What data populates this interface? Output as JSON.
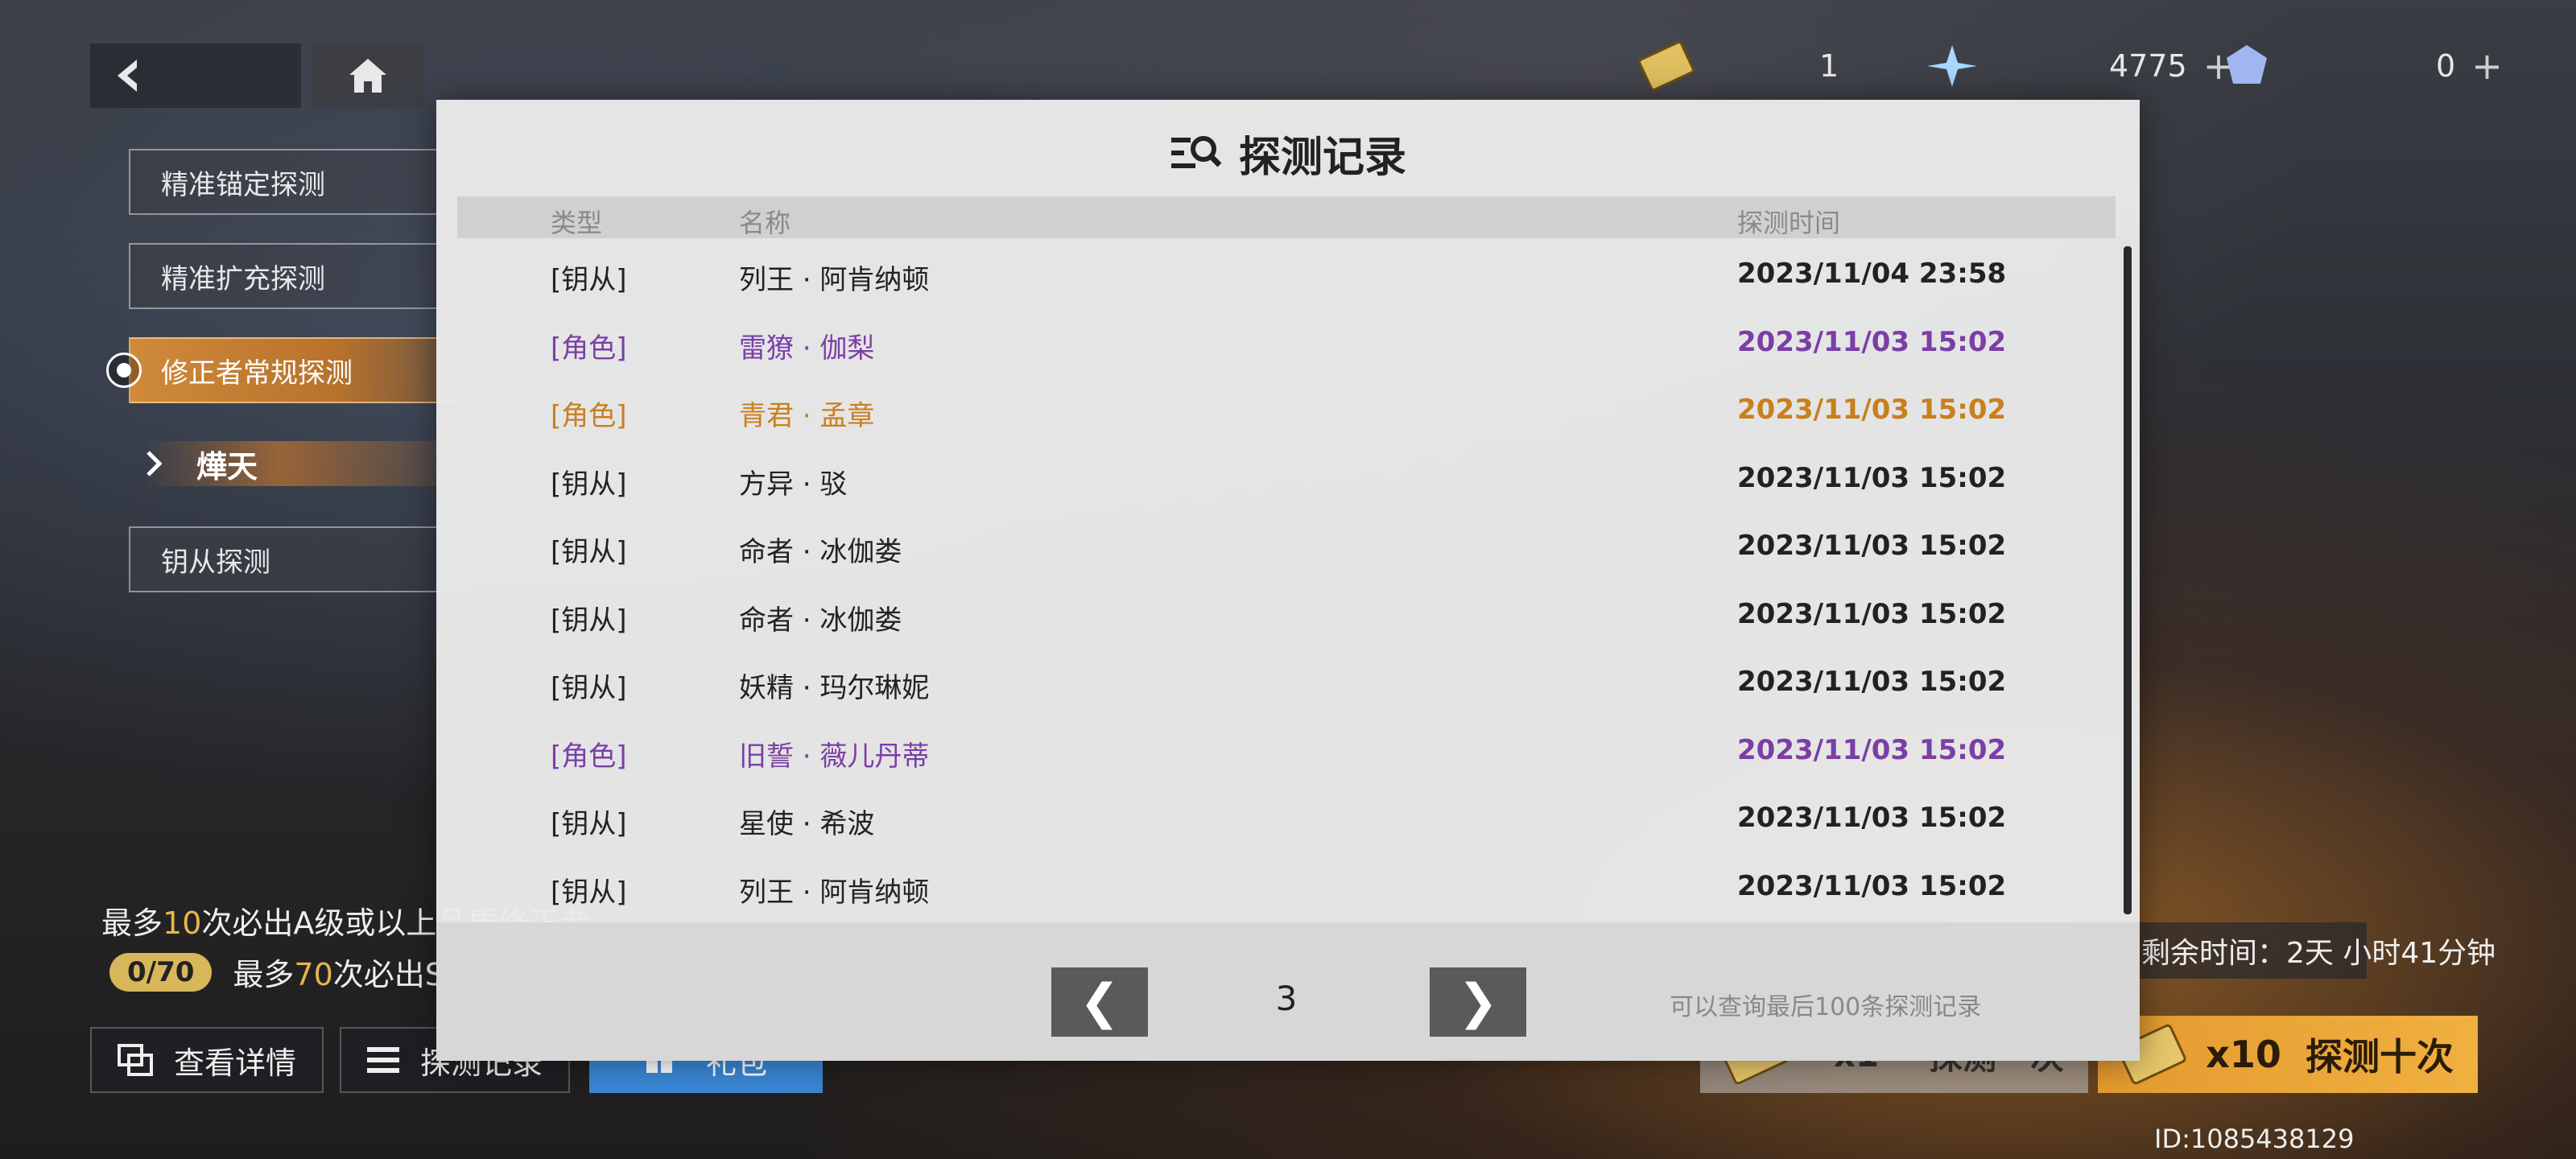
{
  "nav": {
    "back_icon": "back-arrow-icon",
    "home_icon": "home-icon"
  },
  "menu": {
    "items": [
      {
        "label": "精准锚定探测"
      },
      {
        "label": "精准扩充探测"
      },
      {
        "label": "修正者常规探测"
      },
      {
        "label": "钥从探测"
      }
    ],
    "sub_item": "燁天"
  },
  "resources": {
    "ticket_count": "1",
    "crystal_count": "4775",
    "gem_count": "0",
    "plus": "+"
  },
  "guarantee": {
    "line1_prefix": "最多",
    "line1_num": "10",
    "line1_suffix": "次必出A级或以上品质修正者",
    "pity_progress": "0/70",
    "line2_prefix": "最多",
    "line2_num": "70",
    "line2_suffix": "次必出S级修正者"
  },
  "bottom_buttons": {
    "details": "查看详情",
    "records": "探测记录",
    "pack": "礼包"
  },
  "timer": "剩余时间：2天 小时41分钟",
  "pull": {
    "single_count": "x1",
    "single_label": "探测一次",
    "ten_count": "x10",
    "ten_label": "探测十次"
  },
  "uid": "ID:1085438129",
  "modal": {
    "title": "探测记录",
    "columns": {
      "type": "类型",
      "name": "名称",
      "time": "探测时间"
    },
    "rows": [
      {
        "type": "[钥从]",
        "name": "列王 · 阿肯纳顿",
        "time": "2023/11/04 23:58",
        "color": "#222222"
      },
      {
        "type": "[角色]",
        "name": "雷獠 · 伽梨",
        "time": "2023/11/03 15:02",
        "color": "#7a3fa6"
      },
      {
        "type": "[角色]",
        "name": "青君 · 孟章",
        "time": "2023/11/03 15:02",
        "color": "#c8801e"
      },
      {
        "type": "[钥从]",
        "name": "方异 · 驳",
        "time": "2023/11/03 15:02",
        "color": "#222222"
      },
      {
        "type": "[钥从]",
        "name": "命者 · 冰伽娄",
        "time": "2023/11/03 15:02",
        "color": "#222222"
      },
      {
        "type": "[钥从]",
        "name": "命者 · 冰伽娄",
        "time": "2023/11/03 15:02",
        "color": "#222222"
      },
      {
        "type": "[钥从]",
        "name": "妖精 · 玛尔琳妮",
        "time": "2023/11/03 15:02",
        "color": "#222222"
      },
      {
        "type": "[角色]",
        "name": "旧誓 · 薇儿丹蒂",
        "time": "2023/11/03 15:02",
        "color": "#7a3fa6"
      },
      {
        "type": "[钥从]",
        "name": "星使 · 希波",
        "time": "2023/11/03 15:02",
        "color": "#222222"
      },
      {
        "type": "[钥从]",
        "name": "列王 · 阿肯纳顿",
        "time": "2023/11/03 15:02",
        "color": "#222222"
      }
    ],
    "pagination": {
      "prev": "❮",
      "page": "3",
      "next": "❯",
      "note": "可以查询最后100条探测记录"
    }
  }
}
